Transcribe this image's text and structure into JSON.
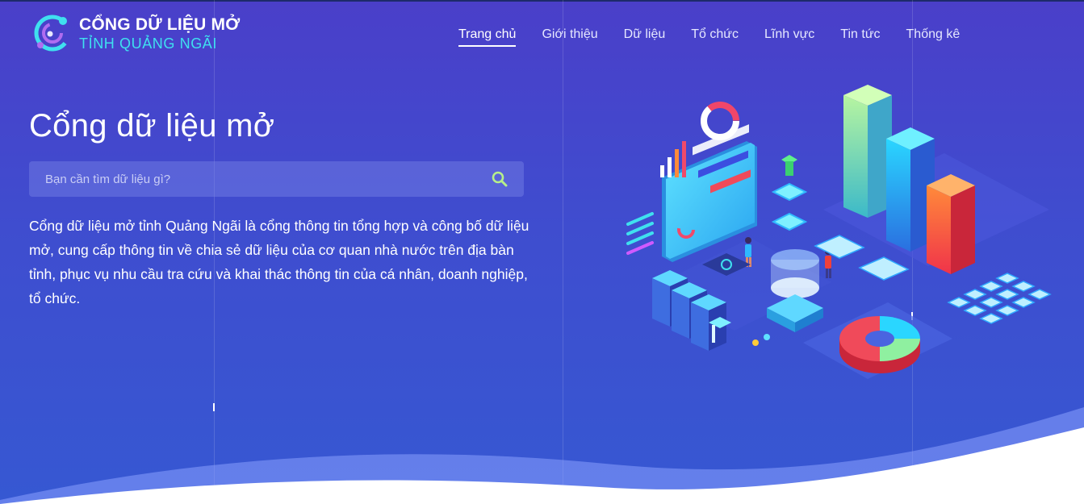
{
  "header": {
    "logo": {
      "line1": "CỔNG DỮ LIỆU MỞ",
      "line2": "TỈNH QUẢNG NGÃI"
    },
    "nav": [
      {
        "label": "Trang chủ",
        "active": true
      },
      {
        "label": "Giới thiệu",
        "active": false
      },
      {
        "label": "Dữ liệu",
        "active": false
      },
      {
        "label": "Tổ chức",
        "active": false
      },
      {
        "label": "Lĩnh vực",
        "active": false
      },
      {
        "label": "Tin tức",
        "active": false
      },
      {
        "label": "Thống kê",
        "active": false
      }
    ]
  },
  "hero": {
    "title": "Cổng dữ liệu mở",
    "search": {
      "placeholder": "Bạn cần tìm dữ liệu gì?",
      "value": "",
      "icon": "search-icon"
    },
    "description": "Cổng dữ liệu mở tỉnh Quảng Ngãi là cổng thông tin tổng hợp và công bố dữ liệu mở, cung cấp thông tin về chia sẻ dữ liệu của cơ quan nhà nước trên địa bàn tỉnh, phục vụ nhu cầu tra cứu và khai thác thông tin của cá nhân, doanh nghiệp, tổ chức."
  },
  "colors": {
    "background_top": "#4a3fc9",
    "background_bottom": "#3658d2",
    "accent_cyan": "#3fe0ef",
    "search_icon": "#b6f08a"
  }
}
